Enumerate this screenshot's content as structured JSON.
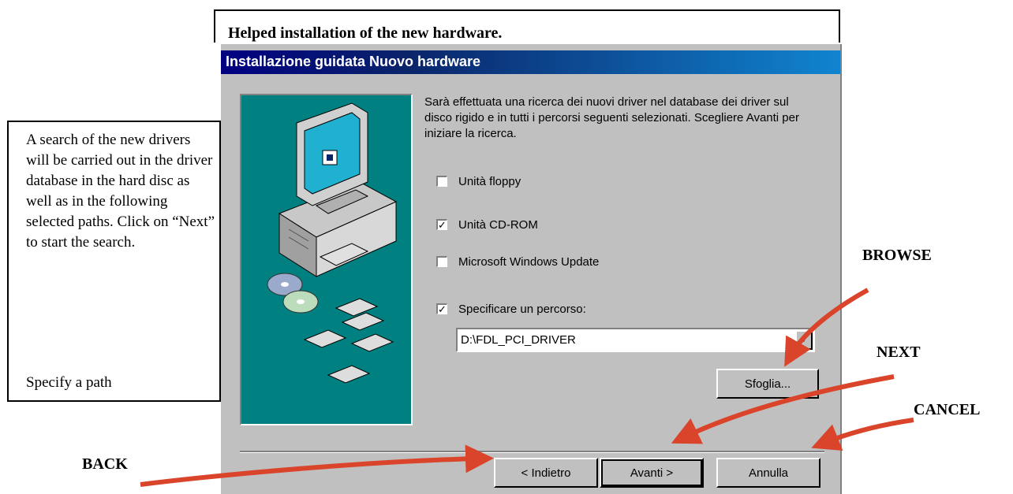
{
  "caption": "Helped installation of the new hardware.",
  "dialog": {
    "title": "Installazione guidata Nuovo hardware",
    "description": "Sarà effettuata una ricerca dei nuovi driver nel database dei driver sul disco rigido e in tutti i percorsi seguenti selezionati. Scegliere Avanti per iniziare la ricerca.",
    "options": [
      {
        "label": "Unità floppy",
        "checked": false
      },
      {
        "label": "Unità CD-ROM",
        "checked": true
      },
      {
        "label": "Microsoft Windows Update",
        "checked": false
      },
      {
        "label": "Specificare un percorso:",
        "checked": true
      }
    ],
    "path_value": "D:\\FDL_PCI_DRIVER",
    "browse_label": "Sfoglia...",
    "back_label": "< Indietro",
    "next_label": "Avanti >",
    "cancel_label": "Annulla"
  },
  "note": {
    "text": "A search of the new drivers will be carried out in the driver database in the hard disc as well as in  the following selected paths. Click on “Next” to start the search.",
    "specify": "Specify a path"
  },
  "annotations": {
    "browse": "BROWSE",
    "next": "NEXT",
    "cancel": "CANCEL",
    "back": "BACK"
  },
  "colors": {
    "title_bar": "#000080",
    "dialog_bg": "#c0c0c0",
    "image_panel": "#008080",
    "arrow": "#d9442b"
  }
}
